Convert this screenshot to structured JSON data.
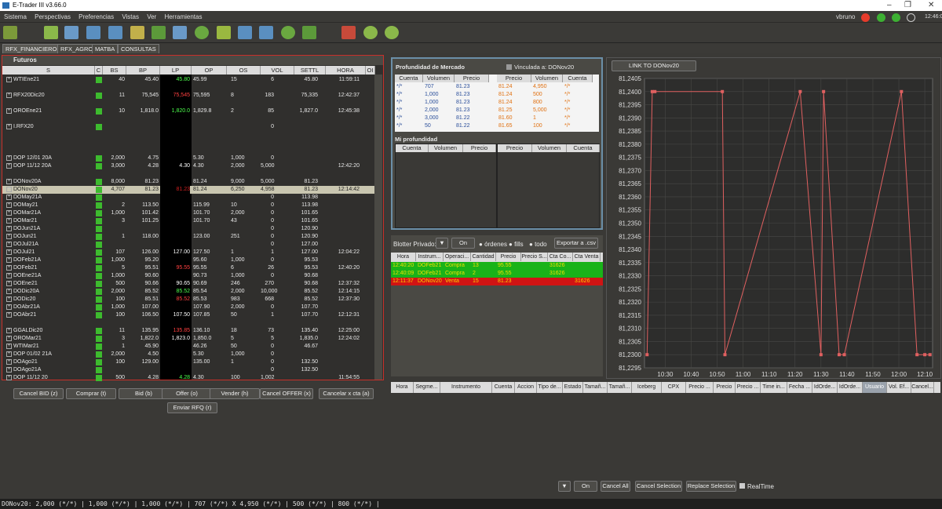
{
  "window": {
    "title": "E-Trader III v3.66.0"
  },
  "menu": [
    "Sistema",
    "Perspectivas",
    "Preferencias",
    "Vistas",
    "Ver",
    "Herramientas"
  ],
  "user": "vbruno",
  "clock": "12:46:02",
  "tabs": [
    "RFX_FINANCIEROS",
    "RFX_AGRO",
    "MATBA",
    "CONSULTAS"
  ],
  "futuros": {
    "title": "Futuros",
    "columns": [
      "S",
      "C",
      "BS",
      "BP",
      "LP",
      "OP",
      "OS",
      "VOL",
      "SETTL",
      "HORA",
      "OI"
    ],
    "rows": [
      {
        "s": "WTIEne21",
        "bs": "40",
        "bp": "45.40",
        "lp": "45.80",
        "lpc": "g",
        "op": "45.99",
        "os": "15",
        "vol": "6",
        "settl": "45.80",
        "hora": "11:59:11",
        "gap": 0
      },
      {
        "s": "RFX20Dic20",
        "bs": "11",
        "bp": "75,545",
        "lp": "75,545",
        "lpc": "r",
        "op": "75,595",
        "os": "8",
        "vol": "183",
        "settl": "75,335",
        "hora": "12:42:37",
        "gap": 1
      },
      {
        "s": "OROEne21",
        "bs": "10",
        "bp": "1,818.0",
        "lp": "1,820.0",
        "lpc": "g",
        "op": "1,829.8",
        "os": "2",
        "vol": "85",
        "settl": "1,827.0",
        "hora": "12:45:38",
        "gap": 1
      },
      {
        "s": "I.RFX20",
        "bs": "",
        "bp": "",
        "lp": "",
        "lpc": "",
        "op": "",
        "os": "",
        "vol": "0",
        "settl": "",
        "hora": "",
        "gap": 1
      },
      {
        "s": "DOP 12/01 20A",
        "bs": "2,000",
        "bp": "4.75",
        "lp": "",
        "lpc": "",
        "op": "5.30",
        "os": "1,000",
        "vol": "0",
        "settl": "",
        "hora": "",
        "gap": 3
      },
      {
        "s": "DOP 11/12 20A",
        "bs": "3,000",
        "bp": "4.28",
        "lp": "4.30",
        "lpc": "w",
        "op": "4.30",
        "os": "2,000",
        "vol": "5,000",
        "settl": "",
        "hora": "12:42:20",
        "gap": 0
      },
      {
        "s": "DONov20A",
        "bs": "8,000",
        "bp": "81.23",
        "lp": "",
        "lpc": "",
        "op": "81.24",
        "os": "9,000",
        "vol": "5,000",
        "settl": "81.23",
        "hora": "",
        "gap": 1
      },
      {
        "s": "DONov20",
        "bs": "4,707",
        "bp": "81.23",
        "lp": "81.23",
        "lpc": "r",
        "op": "81.24",
        "os": "6,250",
        "vol": "4,958",
        "settl": "81.23",
        "hora": "12:14:42",
        "sel": true,
        "gap": 0
      },
      {
        "s": "DOMay21A",
        "bs": "",
        "bp": "",
        "lp": "",
        "lpc": "",
        "op": "",
        "os": "",
        "vol": "0",
        "settl": "113.98",
        "hora": "",
        "gap": 0
      },
      {
        "s": "DOMay21",
        "bs": "2",
        "bp": "113.50",
        "lp": "",
        "lpc": "",
        "op": "115.99",
        "os": "10",
        "vol": "0",
        "settl": "113.98",
        "hora": "",
        "gap": 0
      },
      {
        "s": "DOMar21A",
        "bs": "1,000",
        "bp": "101.42",
        "lp": "",
        "lpc": "",
        "op": "101.70",
        "os": "2,000",
        "vol": "0",
        "settl": "101.65",
        "hora": "",
        "gap": 0
      },
      {
        "s": "DOMar21",
        "bs": "3",
        "bp": "101.25",
        "lp": "",
        "lpc": "",
        "op": "101.70",
        "os": "43",
        "vol": "0",
        "settl": "101.65",
        "hora": "",
        "gap": 0
      },
      {
        "s": "DOJun21A",
        "bs": "",
        "bp": "",
        "lp": "",
        "lpc": "",
        "op": "",
        "os": "",
        "vol": "0",
        "settl": "120.90",
        "hora": "",
        "gap": 0
      },
      {
        "s": "DOJun21",
        "bs": "1",
        "bp": "118.00",
        "lp": "",
        "lpc": "",
        "op": "123.00",
        "os": "251",
        "vol": "0",
        "settl": "120.90",
        "hora": "",
        "gap": 0
      },
      {
        "s": "DOJul21A",
        "bs": "",
        "bp": "",
        "lp": "",
        "lpc": "",
        "op": "",
        "os": "",
        "vol": "0",
        "settl": "127.00",
        "hora": "",
        "gap": 0
      },
      {
        "s": "DOJul21",
        "bs": "107",
        "bp": "126.00",
        "lp": "127.00",
        "lpc": "w",
        "op": "127.50",
        "os": "1",
        "vol": "1",
        "settl": "127.00",
        "hora": "12:04:22",
        "gap": 0
      },
      {
        "s": "DOFeb21A",
        "bs": "1,000",
        "bp": "95.20",
        "lp": "",
        "lpc": "",
        "op": "95.60",
        "os": "1,000",
        "vol": "0",
        "settl": "95.53",
        "hora": "",
        "gap": 0
      },
      {
        "s": "DOFeb21",
        "bs": "5",
        "bp": "95.51",
        "lp": "95.55",
        "lpc": "r",
        "op": "95.55",
        "os": "6",
        "vol": "26",
        "settl": "95.53",
        "hora": "12:40:20",
        "gap": 0
      },
      {
        "s": "DOEne21A",
        "bs": "1,000",
        "bp": "90.60",
        "lp": "",
        "lpc": "",
        "op": "90.73",
        "os": "1,000",
        "vol": "0",
        "settl": "90.68",
        "hora": "",
        "gap": 0
      },
      {
        "s": "DOEne21",
        "bs": "500",
        "bp": "90.66",
        "lp": "90.65",
        "lpc": "w",
        "op": "90.69",
        "os": "246",
        "vol": "270",
        "settl": "90.68",
        "hora": "12:37:32",
        "gap": 0
      },
      {
        "s": "DODic20A",
        "bs": "2,000",
        "bp": "85.52",
        "lp": "85.52",
        "lpc": "g",
        "op": "85.54",
        "os": "2,000",
        "vol": "10,000",
        "settl": "85.52",
        "hora": "12:14:15",
        "gap": 0
      },
      {
        "s": "DODic20",
        "bs": "100",
        "bp": "85.51",
        "lp": "85.52",
        "lpc": "r",
        "op": "85.53",
        "os": "983",
        "vol": "668",
        "settl": "85.52",
        "hora": "12:37:30",
        "gap": 0
      },
      {
        "s": "DOAbr21A",
        "bs": "1,000",
        "bp": "107.00",
        "lp": "",
        "lpc": "",
        "op": "107.90",
        "os": "2,000",
        "vol": "0",
        "settl": "107.70",
        "hora": "",
        "gap": 0
      },
      {
        "s": "DOAbr21",
        "bs": "100",
        "bp": "106.50",
        "lp": "107.50",
        "lpc": "w",
        "op": "107.85",
        "os": "50",
        "vol": "1",
        "settl": "107.70",
        "hora": "12:12:31",
        "gap": 0
      },
      {
        "s": "GGALDic20",
        "bs": "11",
        "bp": "135.95",
        "lp": "135.85",
        "lpc": "r",
        "op": "136.10",
        "os": "18",
        "vol": "73",
        "settl": "135.40",
        "hora": "12:25:00",
        "gap": 1
      },
      {
        "s": "OROMar21",
        "bs": "3",
        "bp": "1,822.0",
        "lp": "1,823.0",
        "lpc": "w",
        "op": "1,850.0",
        "os": "5",
        "vol": "5",
        "settl": "1,835.0",
        "hora": "12:24:02",
        "gap": 0
      },
      {
        "s": "WTIMar21",
        "bs": "1",
        "bp": "45.90",
        "lp": "",
        "lpc": "",
        "op": "46.26",
        "os": "50",
        "vol": "0",
        "settl": "46.67",
        "hora": "",
        "gap": 0
      },
      {
        "s": "DOP 01/02 21A",
        "bs": "2,000",
        "bp": "4.50",
        "lp": "",
        "lpc": "",
        "op": "5.30",
        "os": "1,000",
        "vol": "0",
        "settl": "",
        "hora": "",
        "gap": 0
      },
      {
        "s": "DOAgo21",
        "bs": "100",
        "bp": "129.00",
        "lp": "",
        "lpc": "",
        "op": "135.00",
        "os": "1",
        "vol": "0",
        "settl": "132.50",
        "hora": "",
        "gap": 0
      },
      {
        "s": "DOAgo21A",
        "bs": "",
        "bp": "",
        "lp": "",
        "lpc": "",
        "op": "",
        "os": "",
        "vol": "0",
        "settl": "132.50",
        "hora": "",
        "gap": 0
      },
      {
        "s": "DOP 11/12 20",
        "bs": "500",
        "bp": "4.28",
        "lp": "4.28",
        "lpc": "g",
        "op": "4.30",
        "os": "100",
        "vol": "1,002",
        "settl": "",
        "hora": "11:54:55",
        "gap": 0
      }
    ]
  },
  "actions": {
    "cancel_bid": "Cancel BID (z)",
    "comprar": "Comprar (t)",
    "bid": "Bid (b)",
    "offer": "Offer (o)",
    "vender": "Vender (h)",
    "cancel_offer": "Cancel OFFER (x)",
    "cancelar_cta": "Cancelar x cta (a)",
    "enviar_rfq": "Enviar RFQ (r)"
  },
  "depth": {
    "title": "Profundidad de Mercado",
    "linked_label": "Vinculada a: DONov20",
    "cols_left": [
      "Cuenta",
      "Volumen",
      "Precio"
    ],
    "cols_right": [
      "Precio",
      "Volumen",
      "Cuenta"
    ],
    "bids": [
      [
        "*/*",
        "707",
        "81.23"
      ],
      [
        "*/*",
        "1,000",
        "81.23"
      ],
      [
        "*/*",
        "1,000",
        "81.23"
      ],
      [
        "*/*",
        "2,000",
        "81.23"
      ],
      [
        "*/*",
        "3,000",
        "81.22"
      ],
      [
        "*/*",
        "50",
        "81.22"
      ]
    ],
    "asks": [
      [
        "81.24",
        "4,950",
        "*/*"
      ],
      [
        "81.24",
        "500",
        "*/*"
      ],
      [
        "81.24",
        "800",
        "*/*"
      ],
      [
        "81.25",
        "5,000",
        "*/*"
      ],
      [
        "81.60",
        "1",
        "*/*"
      ],
      [
        "81.65",
        "100",
        "*/*"
      ]
    ],
    "my_title": "Mi profundidad"
  },
  "blotter": {
    "label": "Blotter Privado:",
    "filter_on": "On",
    "radio": [
      "órdenes",
      "fills",
      "todo"
    ],
    "export": "Exportar a .csv",
    "cols": [
      "Hora",
      "Instrum...",
      "Operaci...",
      "Cantidad",
      "Precio",
      "Precio S...",
      "Cta Co...",
      "Cta Venta"
    ],
    "rows": [
      {
        "c": [
          "12:40:20",
          "DOFeb21",
          "Compra",
          "13",
          "95.55",
          "",
          "31626",
          ""
        ],
        "color": "#19b319"
      },
      {
        "c": [
          "12:40:09",
          "DOFeb21",
          "Compra",
          "2",
          "95.55",
          "",
          "31626",
          ""
        ],
        "color": "#19b319"
      },
      {
        "c": [
          "12:11:37",
          "DONov20",
          "Venta",
          "15",
          "81.23",
          "",
          "",
          "31626"
        ],
        "color": "#d01414"
      }
    ]
  },
  "link_button": "LINK TO DONov20",
  "chart_data": {
    "type": "line",
    "x": [
      "10:23",
      "10:25",
      "10:26",
      "10:52",
      "10:53",
      "11:22",
      "11:30",
      "11:31",
      "11:37",
      "11:39",
      "12:01",
      "12:07",
      "12:10",
      "12:12"
    ],
    "values": [
      81.23,
      81.24,
      81.24,
      81.24,
      81.23,
      81.24,
      81.23,
      81.24,
      81.23,
      81.23,
      81.24,
      81.23,
      81.23,
      81.23
    ],
    "xticks": [
      "10:30",
      "10:40",
      "10:50",
      "11:00",
      "11:10",
      "11:20",
      "11:30",
      "11:40",
      "11:50",
      "12:00",
      "12:10"
    ],
    "yticks": [
      "81,2405",
      "81,2400",
      "81,2395",
      "81,2390",
      "81,2385",
      "81,2380",
      "81,2375",
      "81,2370",
      "81,2365",
      "81,2360",
      "81,2355",
      "81,2350",
      "81,2345",
      "81,2340",
      "81,2335",
      "81,2330",
      "81,2325",
      "81,2320",
      "81,2315",
      "81,2310",
      "81,2305",
      "81,2300",
      "81,2295"
    ],
    "ylim": [
      81.2295,
      81.2405
    ],
    "xlim": [
      "10:22",
      "12:13"
    ],
    "color": "#e06060",
    "grid": true
  },
  "orders": {
    "cols": [
      "Hora",
      "Segme...",
      "Instrumento",
      "Cuenta",
      "Accion",
      "Tipo de...",
      "Estado",
      "Tamañ...",
      "Tamañ...",
      "Iceberg",
      "CPX",
      "Precio ...",
      "Precio",
      "Precio ...",
      "Time in...",
      "Fecha ...",
      "IdOrde...",
      "IdOrde...",
      "Usuario",
      "Vol. Ef...",
      "Cancel..."
    ],
    "filter_on": "On",
    "cancel_all": "Cancel All",
    "cancel_selection": "Cancel Selection",
    "replace_selection": "Replace Selection",
    "realtime": "RealTime"
  },
  "status": "DONov20: 2,000 (*/*) | 1,000 (*/*) | 1,000 (*/*) | 707 (*/*)  X 4,950 (*/*) | 500 (*/*) | 800 (*/*) |"
}
